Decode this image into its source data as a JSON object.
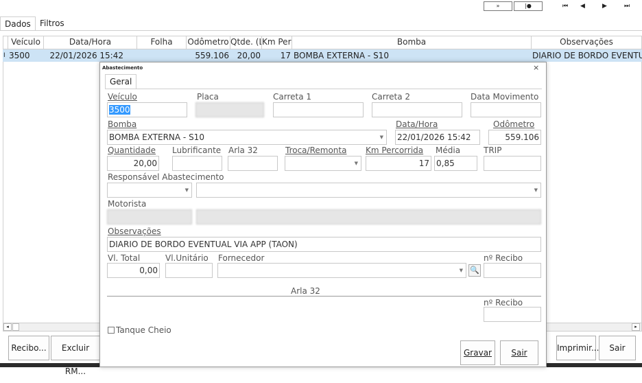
{
  "toolbar": {
    "b1": "»",
    "b2": "|●",
    "first": "⏮",
    "prev": "◀",
    "next": "▶",
    "last": "⏭"
  },
  "tabs": {
    "dados": "Dados",
    "filtros": "Filtros"
  },
  "grid": {
    "headers": [
      "Veículo",
      "Data/Hora",
      "Folha",
      "Odômetro",
      "Qtde. (Lts)",
      "Km Perc",
      "Bomba",
      "Observações"
    ],
    "row": {
      "indicator": "I",
      "veiculo": "3500",
      "data": "22/01/2026 15:42",
      "folha": "",
      "odometro": "559.106",
      "qtde": "20,00",
      "km": "17",
      "bomba": "BOMBA EXTERNA - S10",
      "obs": "DIARIO DE BORDO EVENTU"
    }
  },
  "bottom": {
    "recibo": "Recibo...",
    "excluir": "Excluir RM...",
    "imprimir": "Imprimir...",
    "sair": "Sair"
  },
  "dialog": {
    "title": "Abastecimento",
    "close": "×",
    "tab": "Geral",
    "labels": {
      "veiculo": "Veículo",
      "placa": "Placa",
      "carreta1": "Carreta 1",
      "carreta2": "Carreta 2",
      "data_mov": "Data Movimento",
      "bomba": "Bomba",
      "data_hora": "Data/Hora",
      "odometro": "Odômetro",
      "quantidade": "Quantidade",
      "lubrificante": "Lubrificante",
      "arla": "Arla 32",
      "troca": "Troca/Remonta",
      "km": "Km Percorrida",
      "media": "Média",
      "trip": "TRIP",
      "responsavel": "Responsável Abastecimento",
      "motorista": "Motorista",
      "observacoes": "Observações",
      "vl_total": "Vl. Total",
      "vl_unit": "Vl.Unitário",
      "fornecedor": "Fornecedor",
      "recibo": "nº Recibo",
      "arla_section": "Arla 32",
      "recibo2": "nº Recibo",
      "tanque": "Tanque Cheio"
    },
    "values": {
      "veiculo": "3500",
      "placa": "",
      "carreta1": "",
      "carreta2": "",
      "data_mov": "",
      "bomba": "BOMBA EXTERNA - S10",
      "data_hora": "22/01/2026 15:42",
      "odometro": "559.106",
      "quantidade": "20,00",
      "lubrificante": "",
      "arla": "",
      "troca": "",
      "km": "17",
      "media": "0,85",
      "trip": "",
      "resp1": "",
      "resp2": "",
      "motorista1": "",
      "motorista2": "",
      "observacoes": "DIARIO DE BORDO EVENTUAL VIA APP (TAON)",
      "vl_total": "0,00",
      "vl_unit": "",
      "fornecedor": "",
      "recibo": "",
      "recibo2": ""
    },
    "buttons": {
      "gravar": "Gravar",
      "sair": "Sair"
    }
  }
}
